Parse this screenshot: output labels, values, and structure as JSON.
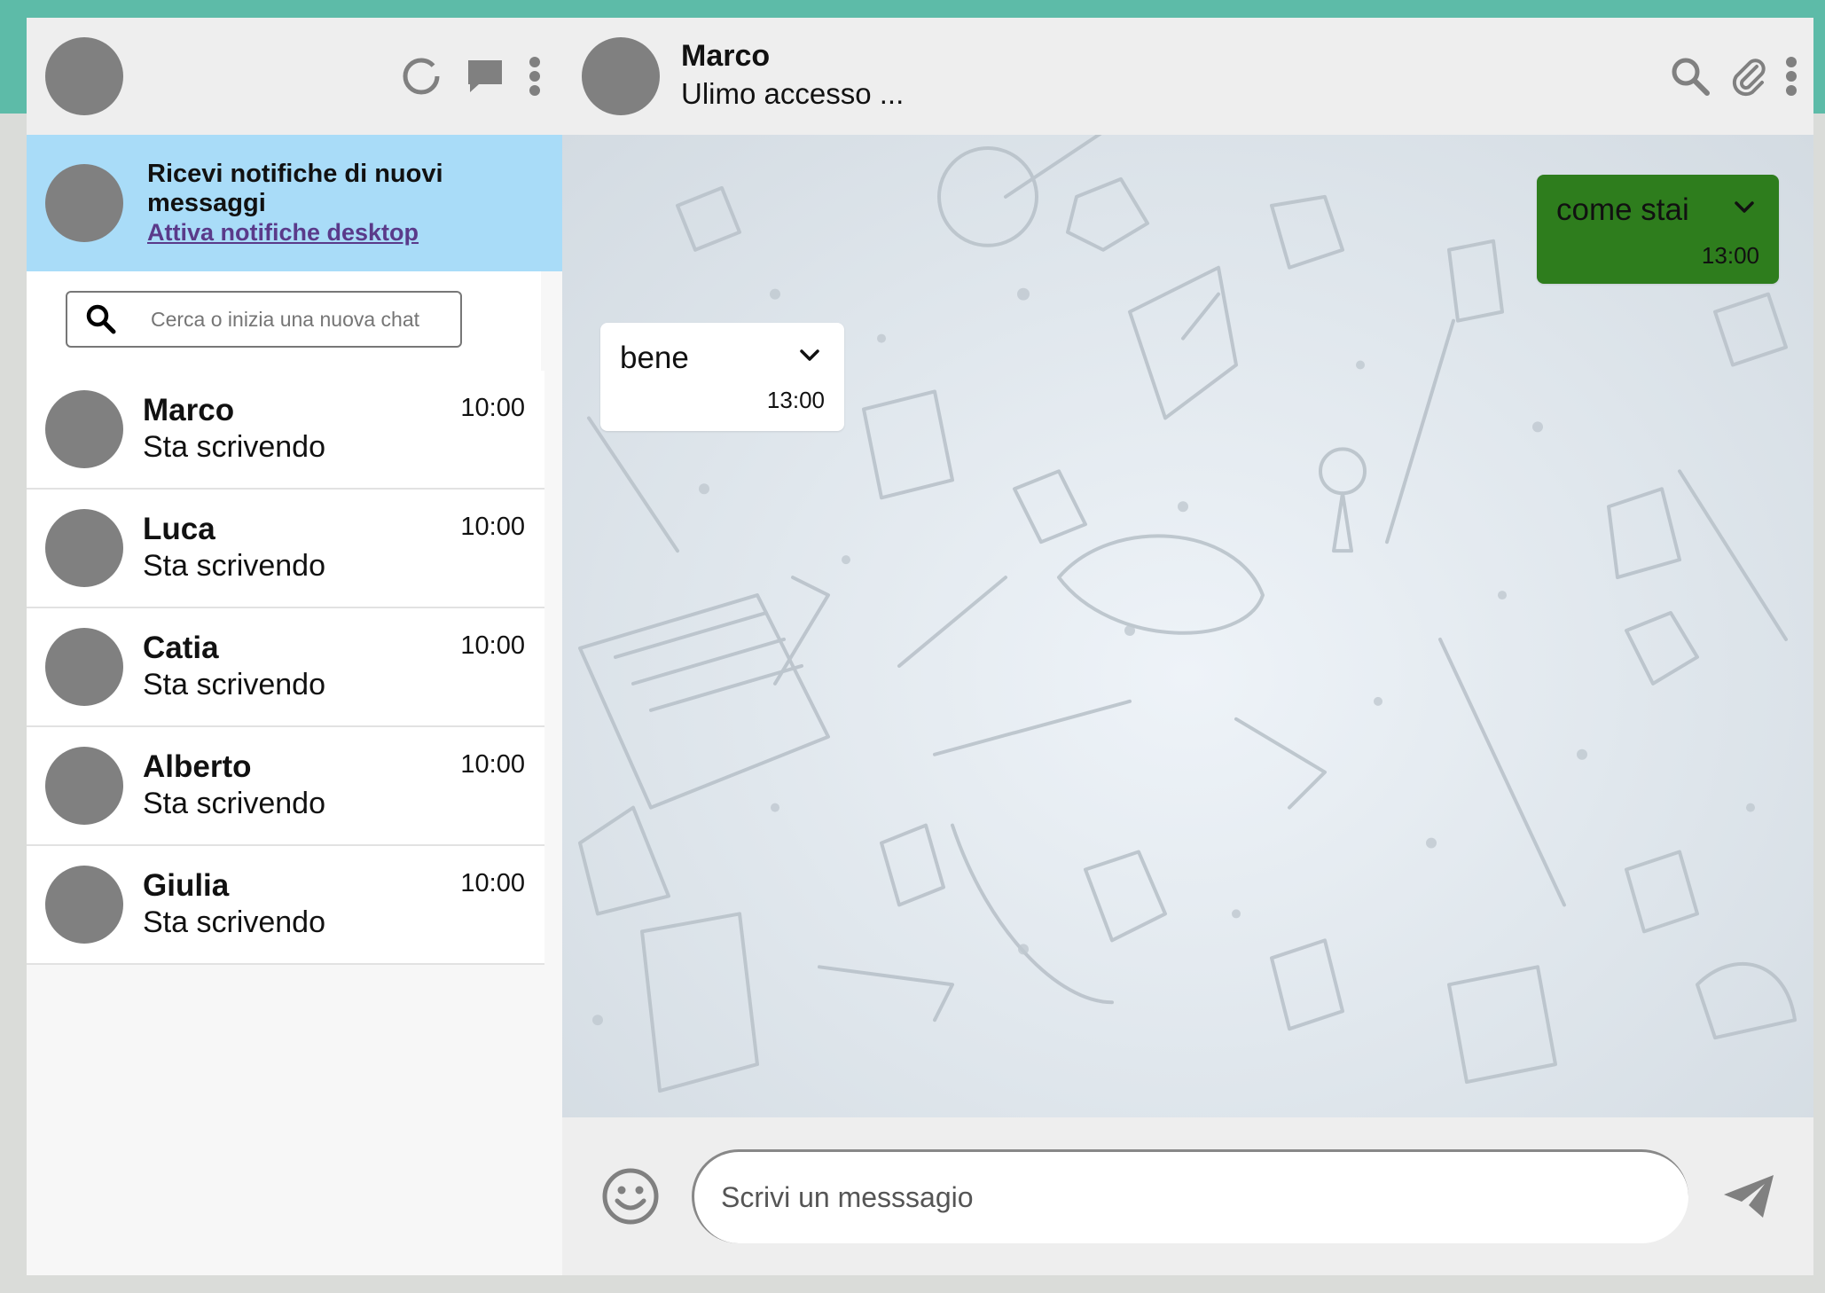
{
  "sidebar": {
    "header_icons": [
      "status-circle-icon",
      "chat-bubble-icon",
      "more-vertical-icon"
    ],
    "notification": {
      "title": "Ricevi notifiche di nuovi messaggi",
      "link": "Attiva notifiche desktop"
    },
    "search": {
      "placeholder": "Cerca o inizia una nuova chat"
    },
    "chats": [
      {
        "name": "Marco",
        "status": "Sta scrivendo",
        "time": "10:00"
      },
      {
        "name": "Luca",
        "status": "Sta scrivendo",
        "time": "10:00"
      },
      {
        "name": "Catia",
        "status": "Sta scrivendo",
        "time": "10:00"
      },
      {
        "name": "Alberto",
        "status": "Sta scrivendo",
        "time": "10:00"
      },
      {
        "name": "Giulia",
        "status": "Sta scrivendo",
        "time": "10:00"
      }
    ]
  },
  "conversation": {
    "contact_name": "Marco",
    "last_seen": "Ulimo accesso ...",
    "header_icons": [
      "search-icon",
      "paperclip-icon",
      "more-vertical-icon"
    ],
    "messages": [
      {
        "direction": "sent",
        "text": "come stai",
        "time": "13:00"
      },
      {
        "direction": "received",
        "text": "bene",
        "time": "13:00"
      }
    ]
  },
  "composer": {
    "placeholder": "Scrivi un messsagio"
  },
  "colors": {
    "top_band": "#5dbba8",
    "notification_bg": "#a9dcf8",
    "sent_bubble": "#2e7d1d",
    "header_bg": "#eeeeee",
    "icon_gray": "#808080"
  }
}
